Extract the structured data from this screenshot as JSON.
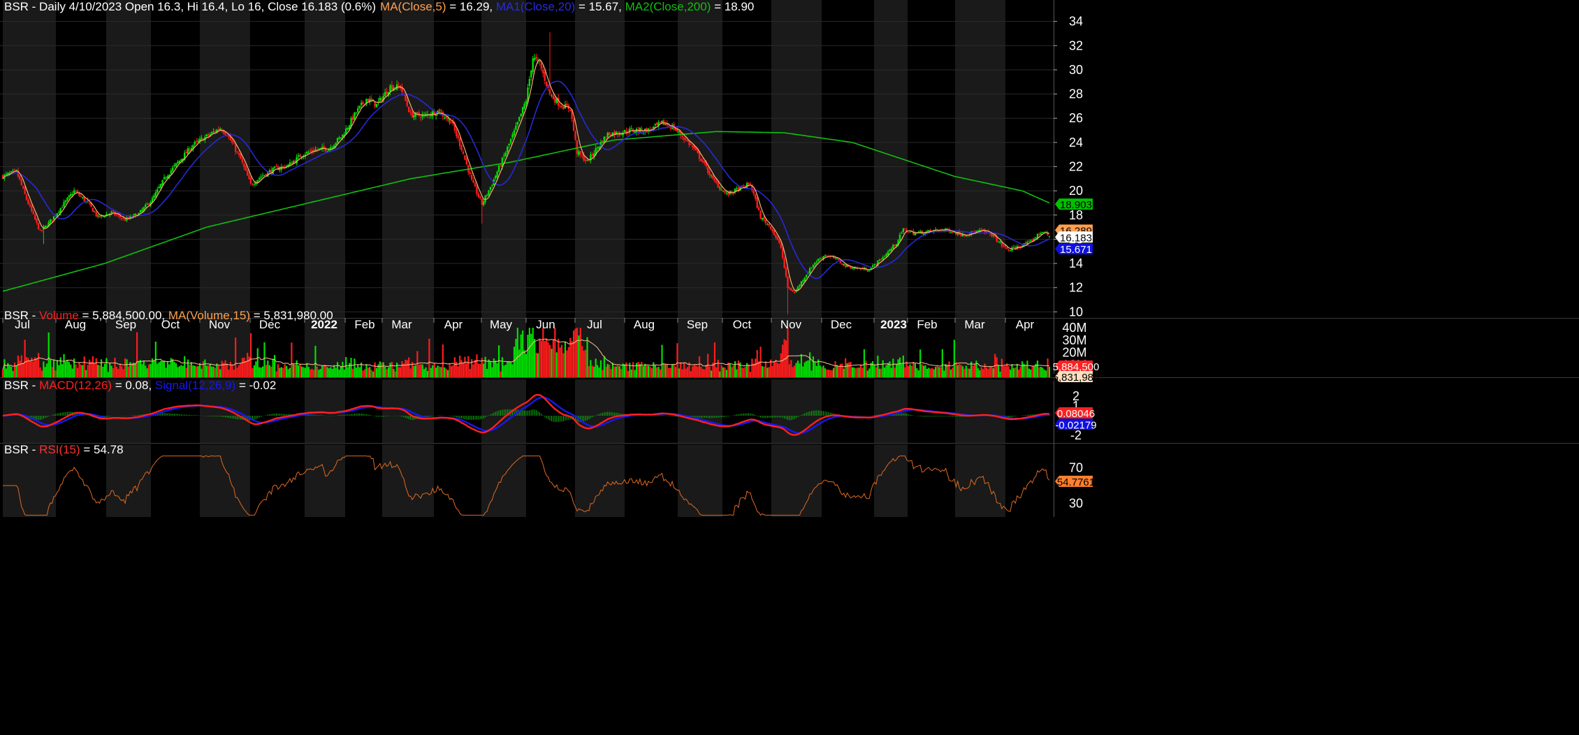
{
  "chart_data": {
    "type": "candlestick",
    "symbol": "BSR",
    "x_months": [
      "Jul",
      "Aug",
      "Sep",
      "Oct",
      "Nov",
      "Dec",
      "2022",
      "Feb",
      "Mar",
      "Apr",
      "May",
      "Jun",
      "Jul",
      "Aug",
      "Sep",
      "Oct",
      "Nov",
      "Dec",
      "2023",
      "Feb",
      "Mar",
      "Apr"
    ],
    "header": {
      "text": "BSR - Daily 4/10/2023 Open 16.3, Hi 16.4, Lo 16, Close 16.183 (0.6%)",
      "ma5": "MA(Close,5)",
      "ma5_val": " = 16.29, ",
      "ma20": "MA1(Close,20)",
      "ma20_val": " = 15.67, ",
      "ma200": "MA2(Close,200)",
      "ma200_val": " = 18.90"
    },
    "price_axis": {
      "ylim": [
        9.5,
        34.5
      ],
      "ticks": [
        "10",
        "12",
        "14",
        "16",
        "18",
        "20",
        "22",
        "24",
        "26",
        "28",
        "30",
        "32",
        "34"
      ]
    },
    "price_markers": [
      {
        "label": "18.903",
        "value": 18.903,
        "bg": "#00c000",
        "fg": "#000000"
      },
      {
        "label": "16.289",
        "value": 16.289,
        "bg": "#ffa050",
        "fg": "#000000"
      },
      {
        "label": "16.183",
        "value": 16.183,
        "bg": "#ffffff",
        "fg": "#000000"
      },
      {
        "label": "15.671",
        "value": 15.671,
        "bg": "#1010e0",
        "fg": "#ffffff"
      }
    ],
    "close_anchors": [
      [
        0,
        21.2
      ],
      [
        8,
        21.6
      ],
      [
        14,
        19.3
      ],
      [
        22,
        16.6
      ],
      [
        28,
        17.5
      ],
      [
        38,
        19.3
      ],
      [
        42,
        20
      ],
      [
        50,
        19
      ],
      [
        56,
        17.8
      ],
      [
        64,
        18.2
      ],
      [
        72,
        17.6
      ],
      [
        80,
        18.1
      ],
      [
        88,
        19.3
      ],
      [
        96,
        21.2
      ],
      [
        104,
        22.5
      ],
      [
        112,
        23.8
      ],
      [
        120,
        24.5
      ],
      [
        128,
        25.2
      ],
      [
        132,
        24.7
      ],
      [
        140,
        22.6
      ],
      [
        146,
        20.5
      ],
      [
        152,
        21.2
      ],
      [
        160,
        21.8
      ],
      [
        168,
        22.1
      ],
      [
        176,
        23
      ],
      [
        184,
        23.4
      ],
      [
        192,
        23.5
      ],
      [
        200,
        24.6
      ],
      [
        208,
        26.5
      ],
      [
        214,
        27.6
      ],
      [
        220,
        27.1
      ],
      [
        228,
        28.6
      ],
      [
        234,
        28.6
      ],
      [
        240,
        26.3
      ],
      [
        248,
        26.2
      ],
      [
        256,
        26.6
      ],
      [
        264,
        25.7
      ],
      [
        270,
        23.5
      ],
      [
        276,
        20.8
      ],
      [
        282,
        18.9
      ],
      [
        288,
        20.6
      ],
      [
        296,
        23.2
      ],
      [
        302,
        25.2
      ],
      [
        308,
        27.5
      ],
      [
        312,
        31
      ],
      [
        316,
        30.5
      ],
      [
        322,
        28
      ],
      [
        328,
        27.1
      ],
      [
        334,
        26.8
      ],
      [
        338,
        23.2
      ],
      [
        344,
        22.4
      ],
      [
        350,
        23.6
      ],
      [
        356,
        24.7
      ],
      [
        362,
        24.8
      ],
      [
        370,
        25
      ],
      [
        380,
        25
      ],
      [
        388,
        25.6
      ],
      [
        394,
        25.3
      ],
      [
        400,
        24.5
      ],
      [
        406,
        23.6
      ],
      [
        412,
        22.4
      ],
      [
        418,
        20.9
      ],
      [
        426,
        19.7
      ],
      [
        434,
        20.2
      ],
      [
        440,
        20.6
      ],
      [
        446,
        17.8
      ],
      [
        452,
        17
      ],
      [
        458,
        15.3
      ],
      [
        462,
        12
      ],
      [
        466,
        11.6
      ],
      [
        472,
        12.9
      ],
      [
        478,
        14.1
      ],
      [
        484,
        14.7
      ],
      [
        490,
        14.4
      ],
      [
        496,
        13.8
      ],
      [
        502,
        13.6
      ],
      [
        510,
        13.5
      ],
      [
        518,
        14.5
      ],
      [
        526,
        15.7
      ],
      [
        530,
        16.8
      ],
      [
        536,
        16.5
      ],
      [
        544,
        16.6
      ],
      [
        552,
        16.8
      ],
      [
        558,
        16.7
      ],
      [
        564,
        16.4
      ],
      [
        570,
        16.5
      ],
      [
        576,
        16.7
      ],
      [
        582,
        16.4
      ],
      [
        588,
        15.5
      ],
      [
        592,
        15.1
      ],
      [
        598,
        15.4
      ],
      [
        604,
        15.7
      ],
      [
        612,
        16.7
      ],
      [
        616,
        16.2
      ]
    ],
    "ma200_anchors": [
      [
        0,
        11.7
      ],
      [
        60,
        14
      ],
      [
        120,
        17
      ],
      [
        180,
        19
      ],
      [
        240,
        21
      ],
      [
        300,
        22.4
      ],
      [
        360,
        24.2
      ],
      [
        420,
        24.9
      ],
      [
        460,
        24.8
      ],
      [
        500,
        24
      ],
      [
        560,
        21.2
      ],
      [
        600,
        20
      ],
      [
        616,
        19
      ]
    ],
    "volume": {
      "ylim": [
        0,
        44
      ],
      "ticks": [
        "10M",
        "20M",
        "30M",
        "40M"
      ]
    },
    "volume_markers": [
      {
        "label": "5,884,500",
        "value": 5.8845,
        "bg": "#ff2020",
        "fg": "#ffffff"
      },
      {
        "label": "5,831,980",
        "value": 5.832,
        "bg": "#ffe0c0",
        "fg": "#000000"
      }
    ],
    "volume_header": {
      "prefix": "BSR - ",
      "vol": "Volume",
      "vol_val": " = 5,884,500.00, ",
      "ma": "MA(Volume,15)",
      "ma_val": " = 5,831,980.00"
    },
    "macd": {
      "ylim": [
        -2.8,
        2.8
      ],
      "ticks": [
        "-2",
        "-1",
        "1",
        "2"
      ]
    },
    "macd_markers": [
      {
        "label": "0.08046",
        "value": 0.08046,
        "bg": "#ff2020",
        "fg": "#ffffff"
      },
      {
        "label": "-0.02179",
        "value": -0.02179,
        "bg": "#1010e0",
        "fg": "#ffffff"
      }
    ],
    "macd_header": {
      "prefix": "BSR - ",
      "macd": "MACD(12,26)",
      "macd_val": " = 0.08, ",
      "signal": "Signal(12,26,9)",
      "signal_val": " = -0.02"
    },
    "rsi": {
      "ylim": [
        15,
        85
      ],
      "ticks": [
        "30",
        "70"
      ]
    },
    "rsi_markers": [
      {
        "label": "54.7761",
        "value": 54.7761,
        "bg": "#ff8030",
        "fg": "#000000"
      }
    ],
    "rsi_header": {
      "prefix": "BSR - ",
      "rsi": "RSI(15)",
      "rsi_val": " = 54.78"
    },
    "colors": {
      "up": "#00e000",
      "down": "#ff1c1c",
      "ma5": "#ffb070",
      "ma20": "#2828d8",
      "ma200": "#10c010",
      "macd": "#ff2020",
      "signal": "#1818f0",
      "rsi": "#e06a20",
      "bg": "#000000",
      "band": "#1a1a1a",
      "grid": "#3a3a3a"
    }
  }
}
